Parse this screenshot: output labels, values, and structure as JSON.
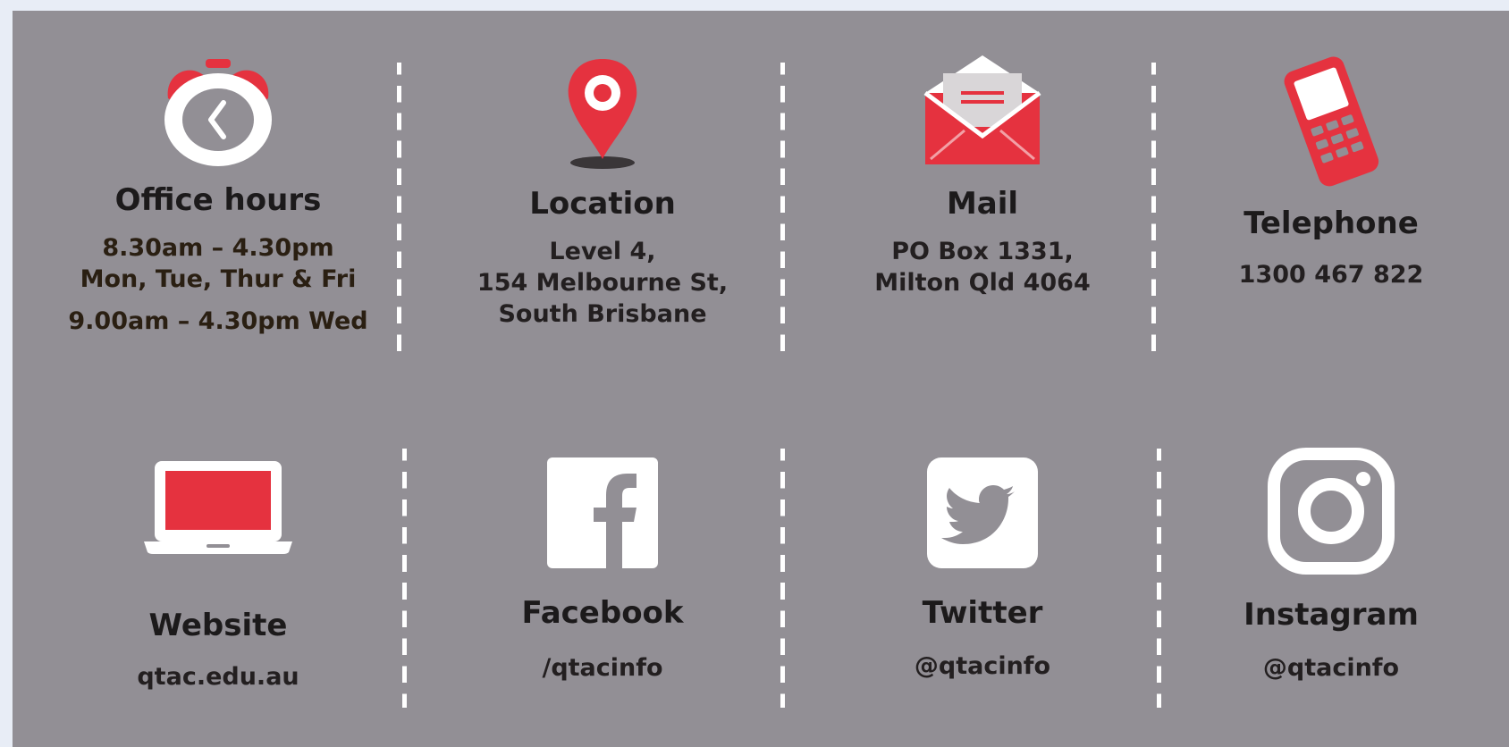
{
  "colors": {
    "background_panel": "#928f95",
    "accent_red": "#e5323f",
    "white": "#ffffff",
    "text": "#231f20"
  },
  "office_hours": {
    "icon": "alarm-clock-icon",
    "title": "Office hours",
    "line1": "8.30am – 4.30pm",
    "line2": "Mon, Tue, Thur & Fri",
    "line3": "9.00am – 4.30pm Wed"
  },
  "location": {
    "icon": "map-pin-icon",
    "title": "Location",
    "line1": "Level 4,",
    "line2": "154 Melbourne St,",
    "line3": "South Brisbane"
  },
  "mail": {
    "icon": "envelope-icon",
    "title": "Mail",
    "line1": "PO Box 1331,",
    "line2": "Milton Qld 4064"
  },
  "telephone": {
    "icon": "mobile-phone-icon",
    "title": "Telephone",
    "line1": "1300 467 822"
  },
  "website": {
    "icon": "laptop-icon",
    "title": "Website",
    "value": "qtac.edu.au"
  },
  "facebook": {
    "icon": "facebook-icon",
    "title": "Facebook",
    "value": "/qtacinfo"
  },
  "twitter": {
    "icon": "twitter-icon",
    "title": "Twitter",
    "value": "@qtacinfo"
  },
  "instagram": {
    "icon": "instagram-icon",
    "title": "Instagram",
    "value": "@qtacinfo"
  }
}
